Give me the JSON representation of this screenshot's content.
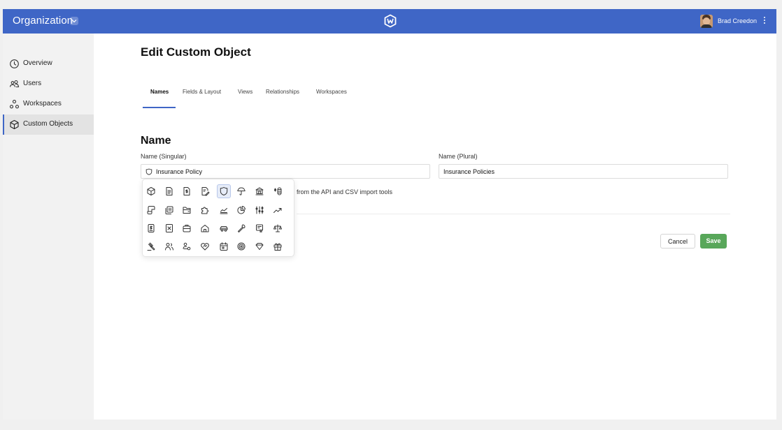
{
  "header": {
    "org_name": "Organization",
    "user_name": "Brad Creedon",
    "logo_icon": "w-hexagon-logo-icon",
    "accent_color": "#3f66c6"
  },
  "sidebar": {
    "items": [
      {
        "label": "Overview",
        "icon": "clock-icon",
        "active": false
      },
      {
        "label": "Users",
        "icon": "users-icon",
        "active": false
      },
      {
        "label": "Workspaces",
        "icon": "workspaces-icon",
        "active": false
      },
      {
        "label": "Custom Objects",
        "icon": "cube-icon",
        "active": true
      }
    ]
  },
  "main": {
    "title": "Edit Custom Object",
    "tabs": [
      {
        "label": "Names",
        "active": true
      },
      {
        "label": "Fields & Layout",
        "active": false
      },
      {
        "label": "Views",
        "active": false
      },
      {
        "label": "Relationships",
        "active": false
      },
      {
        "label": "Workspaces",
        "active": false
      }
    ],
    "section_title": "Name",
    "singular": {
      "label": "Name (Singular)",
      "value": "Insurance Policy",
      "icon": "shield-icon"
    },
    "plural": {
      "label": "Name (Plural)",
      "value": "Insurance Policies"
    },
    "hint": "from the API and CSV import tools",
    "cancel_label": "Cancel",
    "save_label": "Save",
    "save_color": "#58a75a"
  },
  "icon_picker": {
    "selected": "shield-icon",
    "icons": [
      "cube-icon",
      "document-icon",
      "dollar-document-icon",
      "edit-document-icon",
      "shield-icon",
      "umbrella-icon",
      "bank-icon",
      "coins-icon",
      "receipt-icon",
      "documents-icon",
      "folder-icon",
      "puzzle-icon",
      "line-chart-icon",
      "pie-chart-icon",
      "abacus-icon",
      "trending-up-icon",
      "invoice-icon",
      "calculator-icon",
      "briefcase-icon",
      "house-icon",
      "car-icon",
      "wrench-icon",
      "certificate-icon",
      "scale-icon",
      "gavel-icon",
      "user-group-icon",
      "user-connection-icon",
      "heart-icon",
      "calendar-icon",
      "target-icon",
      "diamond-icon",
      "gift-icon"
    ]
  }
}
